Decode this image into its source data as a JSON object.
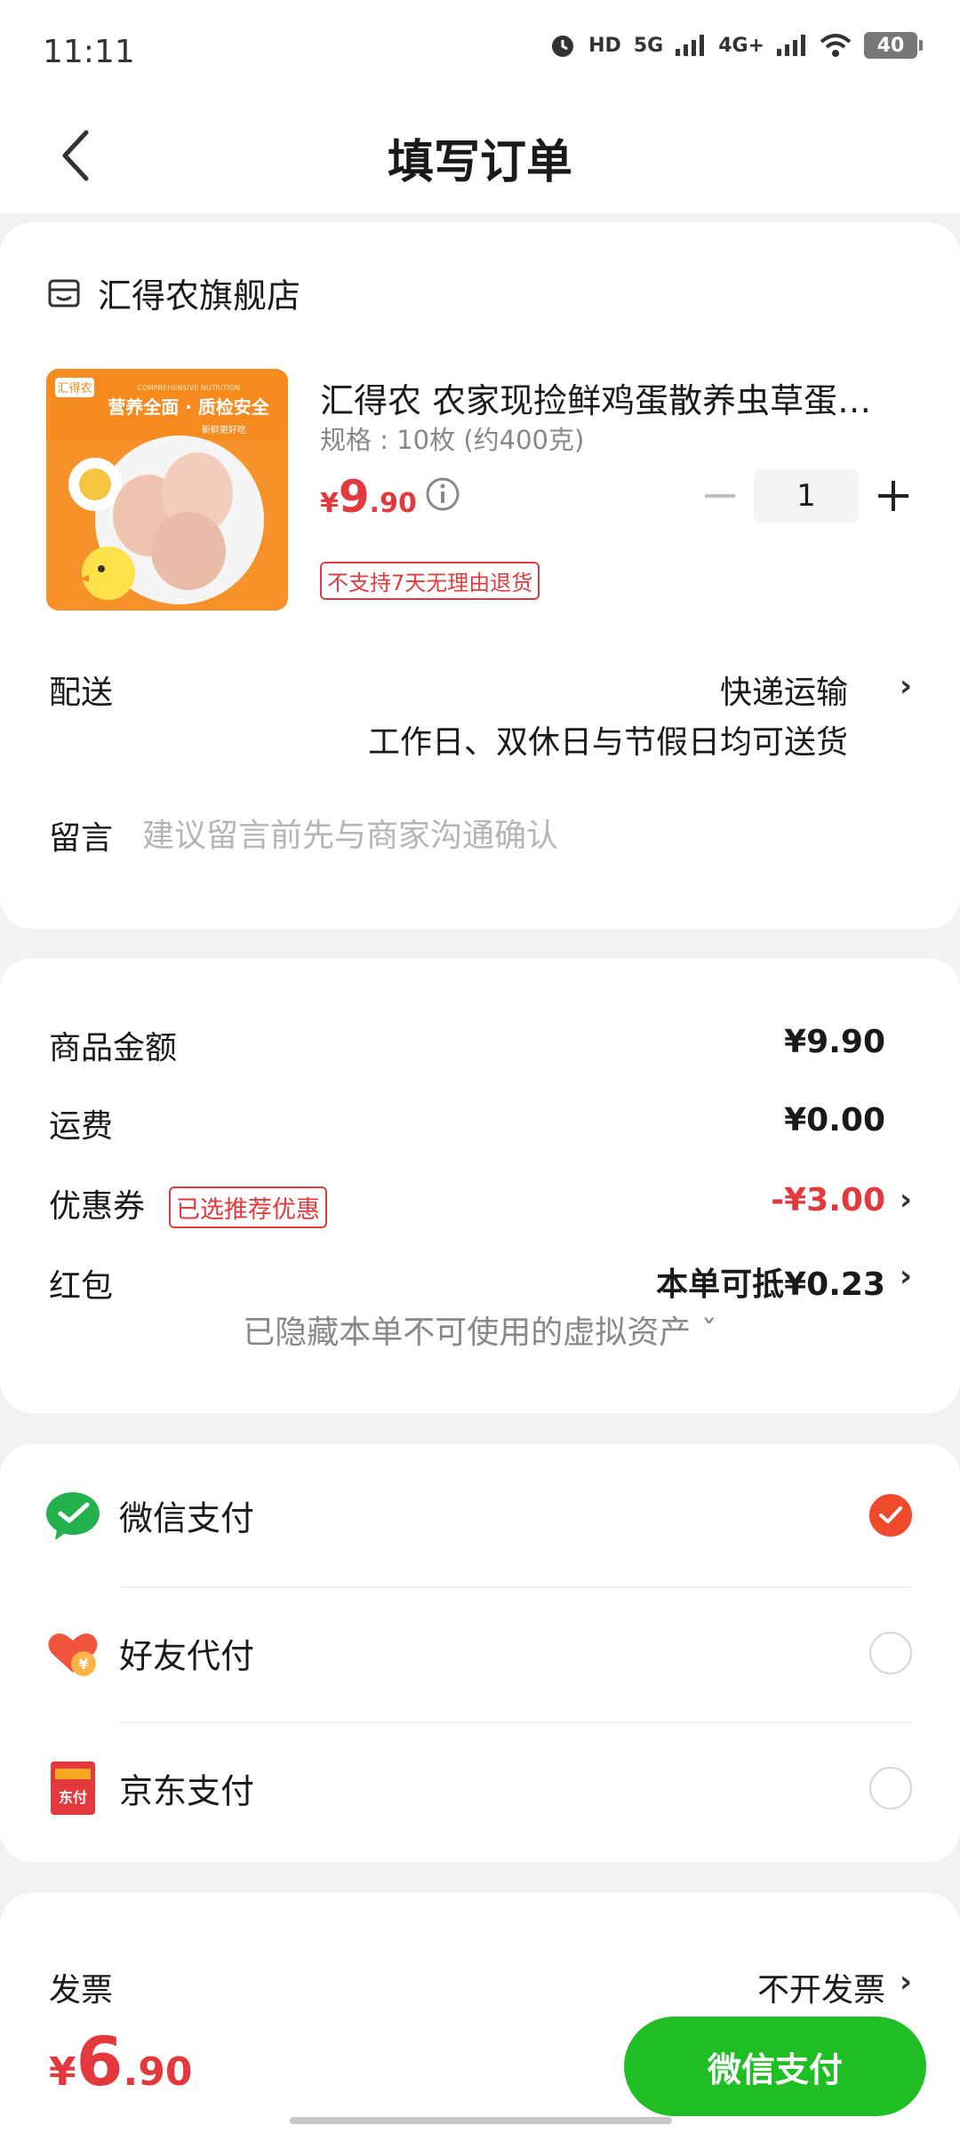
{
  "status_bar": {
    "time": "11:11",
    "network_labels": [
      "HD",
      "5G",
      "4G+"
    ],
    "battery": "40"
  },
  "nav": {
    "title": "填写订单",
    "back_icon": "chevron-left-icon"
  },
  "shop": {
    "name": "汇得农旗舰店",
    "icon": "store-icon"
  },
  "product": {
    "title": "汇得农 农家现捡鲜鸡蛋散养虫草蛋…",
    "spec": "规格 : 10枚 (约400克)",
    "price_currency": "¥",
    "price_int": "9",
    "price_dec": ".90",
    "quantity": "1",
    "no_return_tag": "不支持7天无理由退货",
    "image_text": {
      "brand": "汇得农",
      "banner": "营养全面 · 质检安全",
      "sub": "COMPREHENSIVE NUTRITION",
      "small": "新鲜更好吃"
    }
  },
  "delivery": {
    "label": "配送",
    "method": "快递运输",
    "note": "工作日、双休日与节假日均可送货"
  },
  "message": {
    "label": "留言",
    "placeholder": "建议留言前先与商家沟通确认"
  },
  "summary": {
    "goods_label": "商品金额",
    "goods_value": "¥9.90",
    "shipping_label": "运费",
    "shipping_value": "¥0.00",
    "coupon_label": "优惠券",
    "coupon_badge": "已选推荐优惠",
    "coupon_value": "-¥3.00",
    "redpacket_label": "红包",
    "redpacket_value": "本单可抵¥0.23",
    "hidden_assets": "已隐藏本单不可使用的虚拟资产 ˇ"
  },
  "payment": {
    "options": [
      {
        "label": "微信支付",
        "selected": true
      },
      {
        "label": "好友代付",
        "selected": false
      },
      {
        "label": "京东支付",
        "selected": false
      }
    ],
    "jd_icon_text": "东付",
    "friend_icon_text": "¥"
  },
  "invoice": {
    "label": "发票",
    "value": "不开发票"
  },
  "bottom": {
    "currency": "¥",
    "total_int": "6",
    "total_dec": ".90",
    "pay_button": "微信支付"
  },
  "colors": {
    "red": "#e4393c",
    "green": "#1fbf24",
    "check": "#ef4a2c"
  }
}
